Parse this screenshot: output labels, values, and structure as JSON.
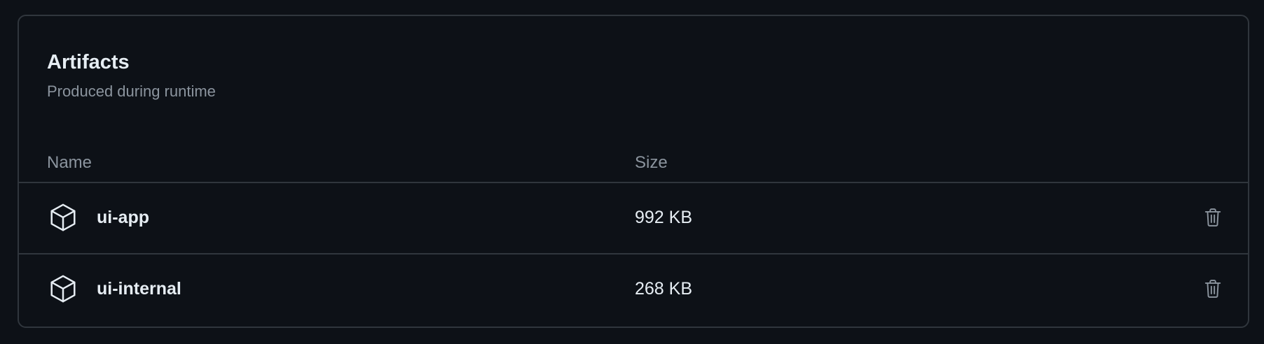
{
  "artifacts": {
    "title": "Artifacts",
    "subtitle": "Produced during runtime",
    "columns": {
      "name": "Name",
      "size": "Size"
    },
    "items": [
      {
        "name": "ui-app",
        "size": "992 KB",
        "icon": "package-icon",
        "action_icon": "trash-icon"
      },
      {
        "name": "ui-internal",
        "size": "268 KB",
        "icon": "package-icon",
        "action_icon": "trash-icon"
      }
    ]
  },
  "colors": {
    "background": "#0d1117",
    "border": "#30363d",
    "text_primary": "#e6edf3",
    "text_muted": "#8b949e"
  }
}
